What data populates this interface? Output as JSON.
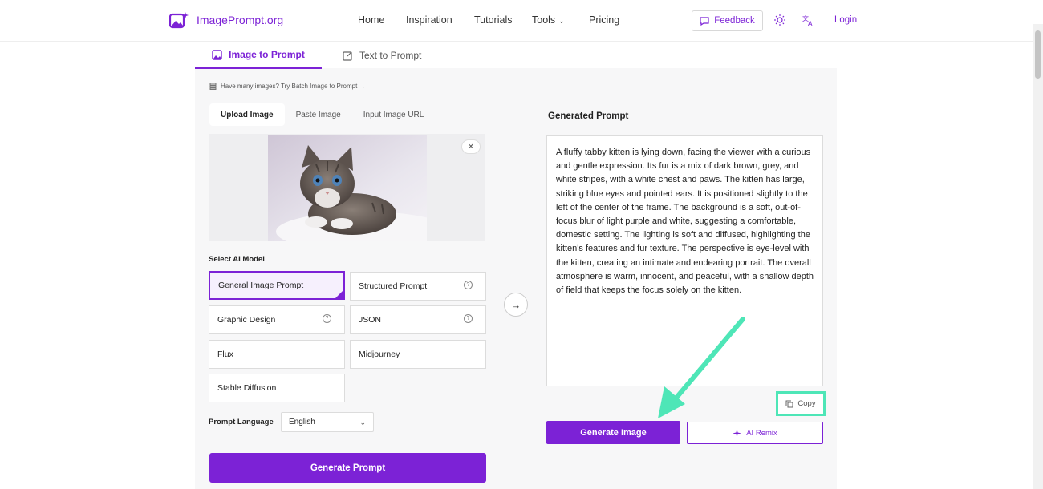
{
  "header": {
    "logo_text": "ImagePrompt.org",
    "nav": [
      "Home",
      "Inspiration",
      "Tutorials",
      "Tools",
      "Pricing"
    ],
    "feedback_label": "Feedback",
    "login_label": "Login"
  },
  "main_tabs": {
    "image_to_prompt": "Image to Prompt",
    "text_to_prompt": "Text to Prompt"
  },
  "batch_hint": "Have many images? Try Batch Image to Prompt →",
  "upload_tabs": [
    "Upload Image",
    "Paste Image",
    "Input Image URL"
  ],
  "select_model_label": "Select AI Model",
  "models": [
    {
      "label": "General Image Prompt",
      "selected": true
    },
    {
      "label": "Structured Prompt"
    },
    {
      "label": "Graphic Design"
    },
    {
      "label": "JSON"
    },
    {
      "label": "Flux"
    },
    {
      "label": "Midjourney"
    },
    {
      "label": "Stable Diffusion"
    }
  ],
  "prompt_language_label": "Prompt Language",
  "prompt_language_value": "English",
  "generate_prompt_label": "Generate Prompt",
  "generated_prompt_title": "Generated Prompt",
  "generated_prompt_text": "A fluffy tabby kitten is lying down, facing the viewer with a curious and gentle expression. Its fur is a mix of dark brown, grey, and white stripes, with a white chest and paws. The kitten has large, striking blue eyes and pointed ears. It is positioned slightly to the left of the center of the frame. The background is a soft, out-of-focus blur of light purple and white, suggesting a comfortable, domestic setting. The lighting is soft and diffused, highlighting the kitten's features and fur texture. The perspective is eye-level with the kitten, creating an intimate and endearing portrait. The overall atmosphere is warm, innocent, and peaceful, with a shallow depth of field that keeps the focus solely on the kitten.",
  "copy_label": "Copy",
  "generate_image_label": "Generate Image",
  "ai_remix_label": "AI Remix",
  "colors": {
    "accent": "#7c22d6",
    "highlight": "#4ee6b7"
  }
}
